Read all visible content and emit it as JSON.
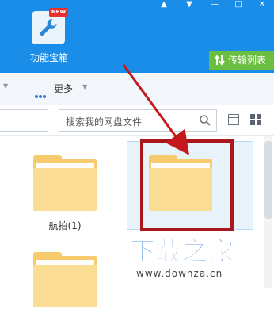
{
  "header": {
    "toolbox_label": "功能宝箱",
    "new_badge": "NEW",
    "transfer_button": "传输列表"
  },
  "toolbar": {
    "more_label": "更多"
  },
  "search": {
    "placeholder": "搜索我的网盘文件"
  },
  "files": [
    {
      "name": "航拍(1)"
    },
    {
      "name": ""
    },
    {
      "name": ""
    }
  ],
  "watermark": {
    "title": "下载之家",
    "url": "www.downza.cn"
  },
  "colors": {
    "header_blue": "#1a8de8",
    "transfer_green": "#6abf43",
    "highlight_red": "#a8171b",
    "folder_yellow": "#fbdc93"
  }
}
